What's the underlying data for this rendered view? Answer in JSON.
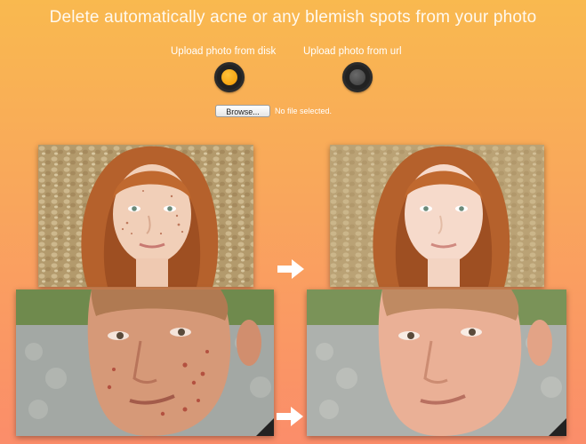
{
  "header": {
    "title": "Delete automatically acne or any blemish spots from your photo"
  },
  "upload": {
    "option_disk": {
      "label": "Upload photo from disk",
      "selected": true
    },
    "option_url": {
      "label": "Upload photo from url",
      "selected": false
    },
    "browse_label": "Browse...",
    "file_status": "No file selected."
  },
  "colors": {
    "selected_radio": "#f7a10b",
    "unselected_radio": "#4a4a4a",
    "arrow": "#ffffff"
  },
  "examples": [
    {
      "name": "woman",
      "before_blemished": true,
      "after_blemished": false
    },
    {
      "name": "man",
      "before_blemished": true,
      "after_blemished": false
    }
  ]
}
